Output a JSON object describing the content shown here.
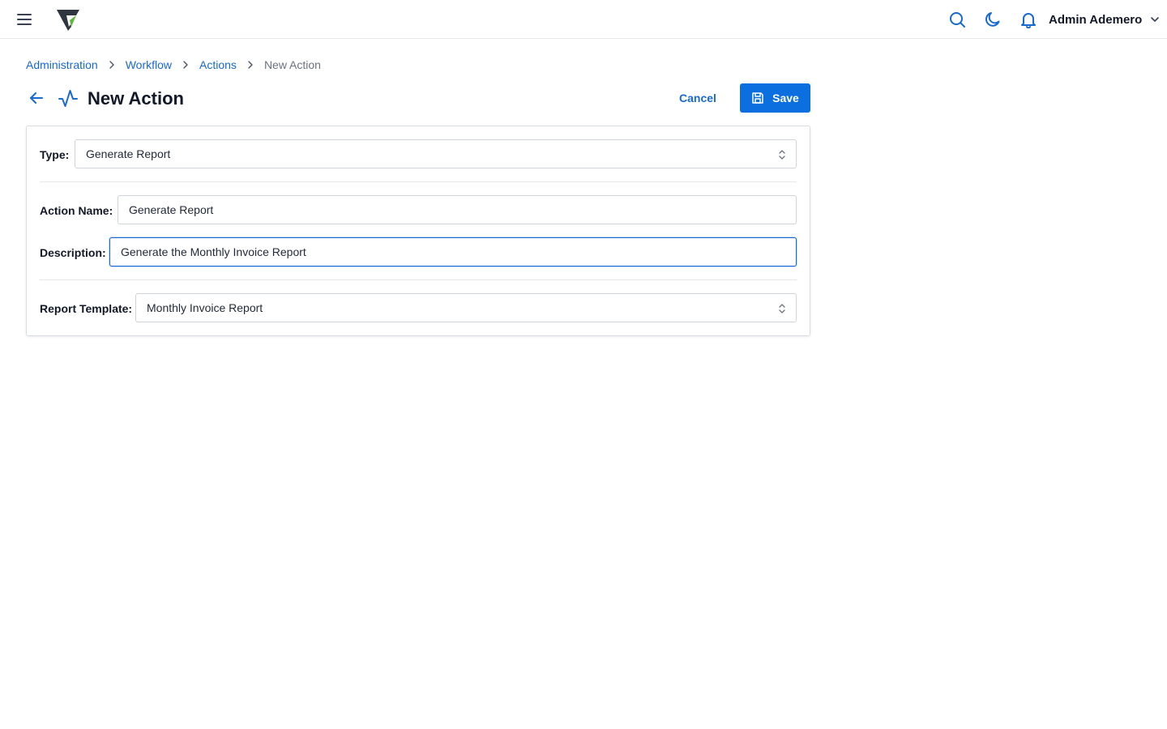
{
  "topbar": {
    "user_name": "Admin Ademero",
    "icons": [
      "menu-icon",
      "search-icon",
      "moon-icon",
      "bell-icon",
      "chevron-down-icon"
    ]
  },
  "breadcrumb": {
    "items": [
      "Administration",
      "Workflow",
      "Actions"
    ],
    "current": "New Action"
  },
  "header": {
    "title": "New Action",
    "cancel_label": "Cancel",
    "save_label": "Save"
  },
  "form": {
    "type": {
      "label": "Type:",
      "value": "Generate Report"
    },
    "action_name": {
      "label": "Action Name:",
      "value": "Generate Report"
    },
    "description": {
      "label": "Description:",
      "value": "Generate the Monthly Invoice Report"
    },
    "report_template": {
      "label": "Report Template:",
      "value": "Monthly Invoice Report"
    }
  },
  "colors": {
    "accent": "#1769d4",
    "primary_button": "#0b6fe0",
    "logo_green": "#5cb83a"
  }
}
